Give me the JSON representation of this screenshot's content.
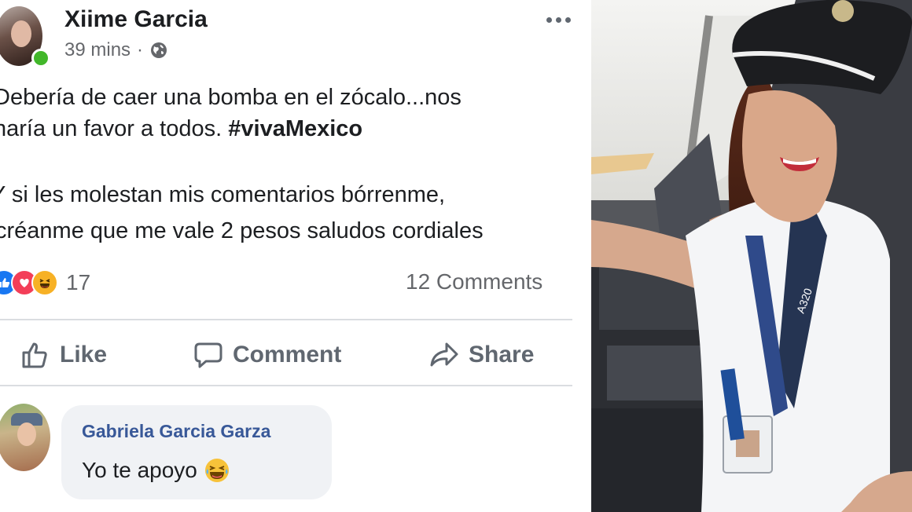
{
  "post": {
    "author": "Xiime Garcia",
    "time": "39 mins",
    "separator": "·",
    "body_lines": [
      "Debería de caer una bomba en el zócalo...nos",
      "haría un favor a todos.",
      "Y si les molestan mis comentarios bórrenme,",
      "créanme que me vale 2 pesos  saludos cordiales"
    ],
    "hashtag": "#vivaMexico",
    "reaction_count": "17",
    "comments_count": "12 Comments",
    "actions": {
      "like": "Like",
      "comment": "Comment",
      "share": "Share"
    }
  },
  "comment": {
    "author": "Gabriela Garcia Garza",
    "text": "Yo te apoyo"
  },
  "photo": {
    "badge_text": "A320"
  },
  "colors": {
    "online": "#42b72a",
    "like": "#1877f2",
    "love": "#f33e58",
    "haha": "#f7b125",
    "comment_name": "#385898",
    "muted": "#65676b"
  },
  "icons": [
    "globe-icon",
    "more-options-icon",
    "like-reaction-icon",
    "love-reaction-icon",
    "haha-reaction-icon",
    "thumbs-up-icon",
    "comment-icon",
    "share-icon",
    "laughing-emoji-icon"
  ]
}
